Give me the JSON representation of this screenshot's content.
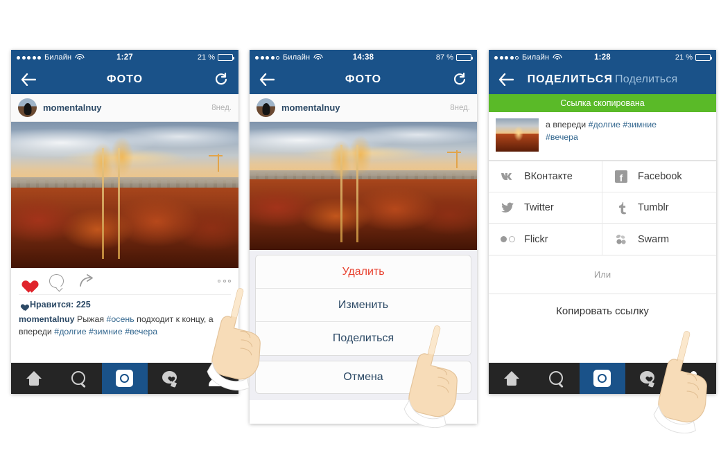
{
  "panels": [
    {
      "id": "photo-view",
      "status": {
        "carrier": "Билайн",
        "signal_filled": 5,
        "signal_total": 5,
        "time": "1:27",
        "battery_text": "21 %",
        "battery_pct": 21
      },
      "nav": {
        "title": "ФОТО",
        "back_icon": "arrow-left-icon",
        "refresh_icon": "refresh-icon"
      },
      "post": {
        "username": "momentalnuy",
        "time_ago": "8нед.",
        "likes_label": "Нравится: 225",
        "likes_count": 225
      },
      "caption": {
        "user": "momentalnuy",
        "text_1": " Рыжая ",
        "tag_1": "#осень",
        "text_2": " подходит к концу, а впереди ",
        "tag_2": "#долгие",
        "tag_3": "#зимние",
        "tag_4": "#вечера"
      }
    },
    {
      "id": "action-sheet-view",
      "status": {
        "carrier": "Билайн",
        "signal_filled": 4,
        "signal_total": 5,
        "time": "14:38",
        "battery_text": "87 %",
        "battery_pct": 87
      },
      "nav": {
        "title": "ФОТО",
        "back_icon": "arrow-left-icon",
        "refresh_icon": "refresh-icon"
      },
      "post": {
        "username": "momentalnuy",
        "time_ago": "8нед."
      },
      "sheet": {
        "delete": "Удалить",
        "edit": "Изменить",
        "share": "Поделиться",
        "cancel": "Отмена"
      }
    },
    {
      "id": "share-view",
      "status": {
        "carrier": "Билайн",
        "signal_filled": 4,
        "signal_total": 5,
        "time": "1:28",
        "battery_text": "21 %",
        "battery_pct": 21
      },
      "nav": {
        "title": "ПОДЕЛИТЬСЯ",
        "title_ghost": "Поделиться",
        "back_icon": "arrow-left-icon"
      },
      "toast": "Ссылка скопирована",
      "preview": {
        "line_1": "а впереди ",
        "tag_1": "#долгие",
        "tag_2": "#зимние",
        "tag_3": "#вечера"
      },
      "share_targets": [
        {
          "label": "ВКонтакте",
          "icon": "vk-icon"
        },
        {
          "label": "Facebook",
          "icon": "facebook-icon"
        },
        {
          "label": "Twitter",
          "icon": "twitter-icon"
        },
        {
          "label": "Tumblr",
          "icon": "tumblr-icon"
        },
        {
          "label": "Flickr",
          "icon": "flickr-icon"
        },
        {
          "label": "Swarm",
          "icon": "swarm-icon"
        }
      ],
      "or_label": "Или",
      "copy_link": "Копировать ссылку"
    }
  ],
  "tabbar": {
    "items": [
      {
        "icon": "home-icon",
        "active": false
      },
      {
        "icon": "search-icon",
        "active": false
      },
      {
        "icon": "camera-icon",
        "active": true
      },
      {
        "icon": "activity-heart-icon",
        "active": false
      },
      {
        "icon": "profile-icon",
        "active": false
      }
    ]
  },
  "colors": {
    "nav_blue": "#1a5289",
    "toast_green": "#5aba28",
    "danger_red": "#e8412f",
    "tabbar_dark": "#252525",
    "link_blue": "#33678f",
    "heart_red": "#e0242c"
  }
}
